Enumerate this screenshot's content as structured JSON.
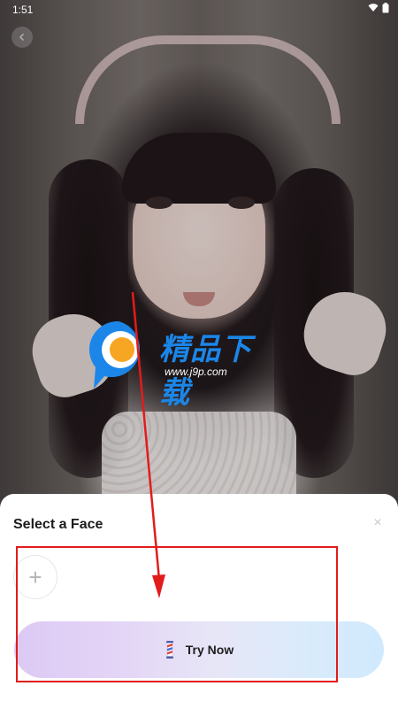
{
  "status_bar": {
    "time": "1:51"
  },
  "watermark": {
    "brand": "精品下载",
    "url": "www.j9p.com"
  },
  "sheet": {
    "title": "Select a Face",
    "add_label": "+",
    "close_label": "×"
  },
  "primary_action": {
    "label": "Try Now"
  },
  "icons": {
    "back": "back-icon",
    "wifi": "wifi-icon",
    "battery": "battery-icon",
    "close": "close-icon",
    "add": "plus-icon",
    "barber": "barber-pole-icon"
  },
  "colors": {
    "annotation": "#e21b1b",
    "watermark_brand": "#1b86e8",
    "button_gradient_start": "#dcc9f5",
    "button_gradient_end": "#d0e9fd"
  }
}
